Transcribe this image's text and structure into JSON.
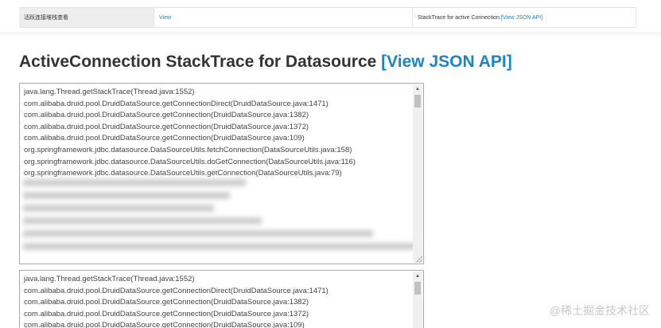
{
  "top_table": {
    "col1": "活跃连接堆栈查看",
    "col2_link": "View",
    "col3_text": "StackTrace for active Connection.",
    "col3_link": "[View JSON API]"
  },
  "heading": {
    "title": "ActiveConnection StackTrace for Datasource",
    "link": "[View JSON API]"
  },
  "trace_box_1": {
    "lines": [
      "java.lang.Thread.getStackTrace(Thread.java:1552)",
      "com.alibaba.druid.pool.DruidDataSource.getConnectionDirect(DruidDataSource.java:1471)",
      "com.alibaba.druid.pool.DruidDataSource.getConnection(DruidDataSource.java:1382)",
      "com.alibaba.druid.pool.DruidDataSource.getConnection(DruidDataSource.java:1372)",
      "com.alibaba.druid.pool.DruidDataSource.getConnection(DruidDataSource.java:109)",
      "org.springframework.jdbc.datasource.DataSourceUtils.fetchConnection(DataSourceUtils.java:158)",
      "org.springframework.jdbc.datasource.DataSourceUtils.doGetConnection(DataSourceUtils.java:116)",
      "org.springframework.jdbc.datasource.DataSourceUtils.getConnection(DataSourceUtils.java:79)"
    ]
  },
  "trace_box_2": {
    "lines": [
      "java.lang.Thread.getStackTrace(Thread.java:1552)",
      "com.alibaba.druid.pool.DruidDataSource.getConnectionDirect(DruidDataSource.java:1471)",
      "com.alibaba.druid.pool.DruidDataSource.getConnection(DruidDataSource.java:1382)",
      "com.alibaba.druid.pool.DruidDataSource.getConnection(DruidDataSource.java:1372)",
      "com.alibaba.druid.pool.DruidDataSource.getConnection(DruidDataSource.java:109)"
    ]
  },
  "scroll_icons": {
    "up": "▲",
    "down": "▼"
  },
  "colors": {
    "link": "#1b84c3",
    "heading": "#333333",
    "border": "#a9a9a9"
  },
  "watermark": "@稀土掘金技术社区"
}
